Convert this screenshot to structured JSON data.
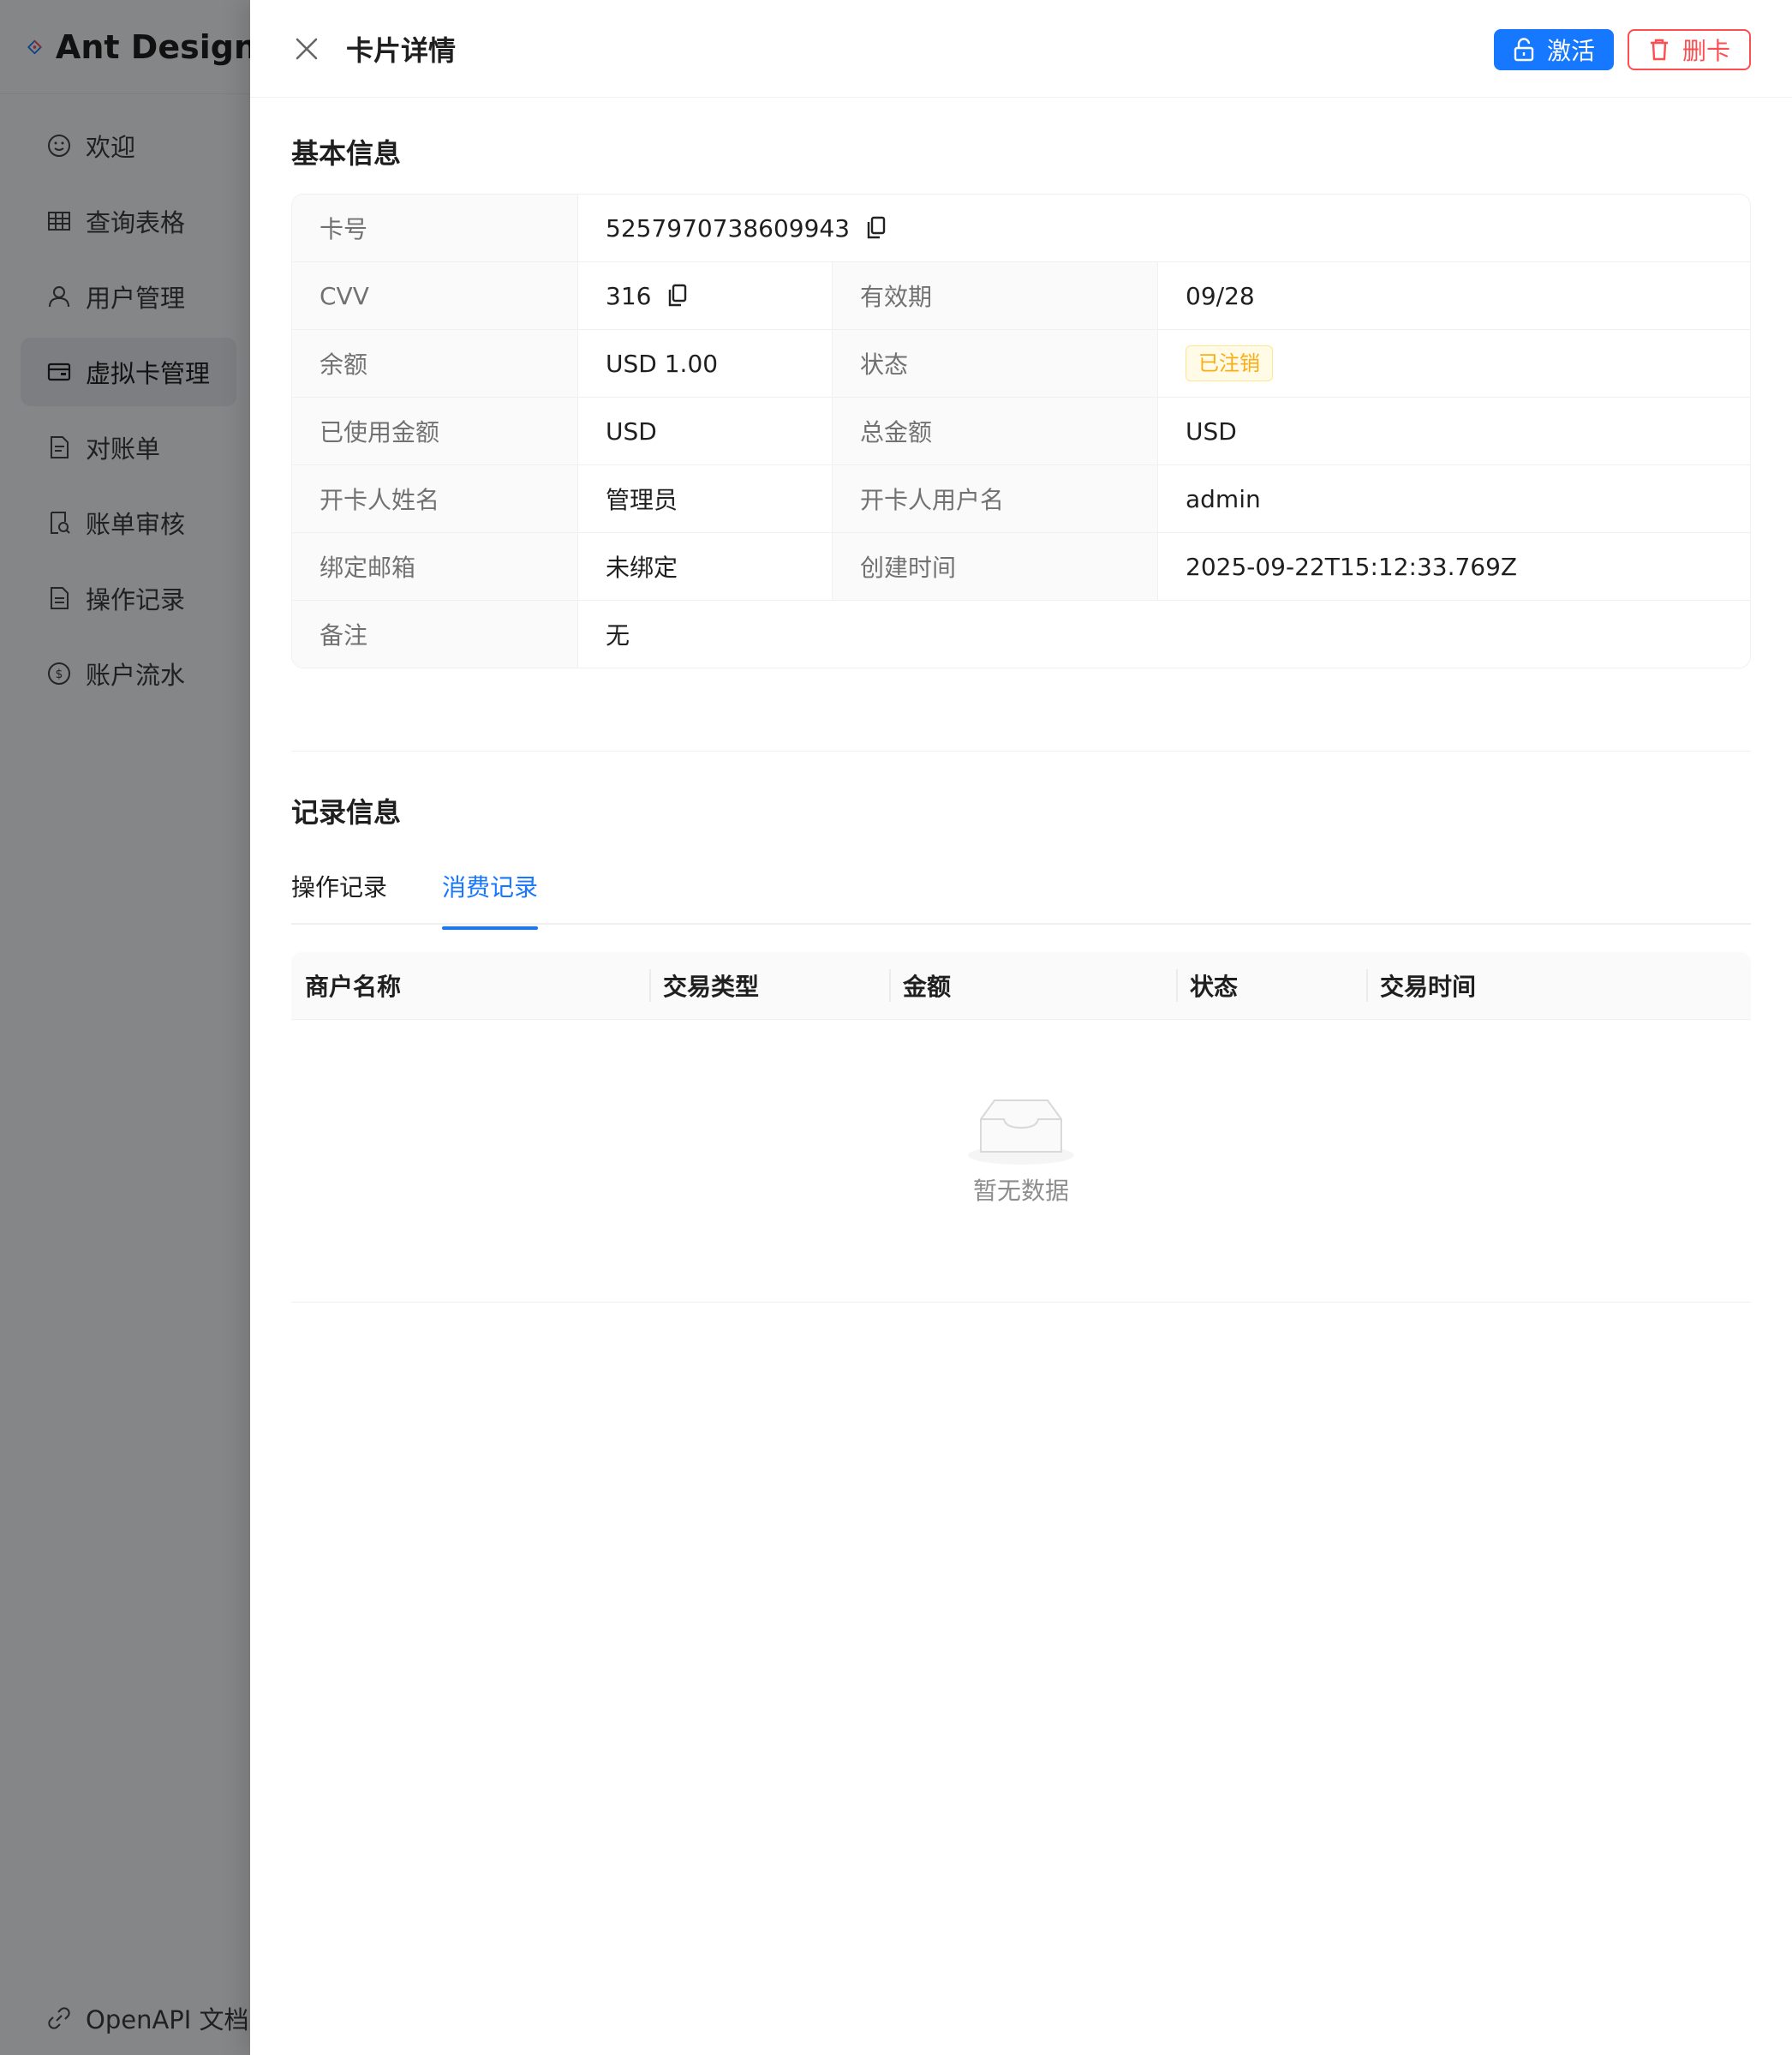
{
  "app": {
    "title": "Ant Design",
    "menu": [
      {
        "label": "欢迎",
        "icon": "smile-icon"
      },
      {
        "label": "查询表格",
        "icon": "table-icon"
      },
      {
        "label": "用户管理",
        "icon": "user-icon"
      },
      {
        "label": "虚拟卡管理",
        "icon": "credit-card-icon",
        "active": true
      },
      {
        "label": "对账单",
        "icon": "file-text-icon"
      },
      {
        "label": "账单审核",
        "icon": "audit-icon"
      },
      {
        "label": "操作记录",
        "icon": "file-icon"
      },
      {
        "label": "账户流水",
        "icon": "dollar-icon"
      }
    ],
    "footer_link": "OpenAPI 文档"
  },
  "drawer": {
    "title": "卡片详情",
    "actions": {
      "activate": "激活",
      "delete": "删卡"
    },
    "basic": {
      "title": "基本信息",
      "card_no_label": "卡号",
      "card_no": "5257970738609943",
      "cvv_label": "CVV",
      "cvv": "316",
      "expiry_label": "有效期",
      "expiry": "09/28",
      "balance_label": "余额",
      "balance": "USD 1.00",
      "status_label": "状态",
      "status": "已注销",
      "used_label": "已使用金额",
      "used": "USD",
      "total_label": "总金额",
      "total": "USD",
      "holder_name_label": "开卡人姓名",
      "holder_name": "管理员",
      "holder_user_label": "开卡人用户名",
      "holder_user": "admin",
      "email_label": "绑定邮箱",
      "email": "未绑定",
      "created_label": "创建时间",
      "created": "2025-09-22T15:12:33.769Z",
      "remark_label": "备注",
      "remark": "无"
    },
    "records": {
      "title": "记录信息",
      "tabs": [
        "操作记录",
        "消费记录"
      ],
      "active_tab": "消费记录",
      "columns": [
        "商户名称",
        "交易类型",
        "金额",
        "状态",
        "交易时间"
      ],
      "empty_text": "暂无数据"
    }
  },
  "colors": {
    "primary": "#1677ff",
    "danger": "#ff4d4f",
    "warning": "#faad14"
  }
}
